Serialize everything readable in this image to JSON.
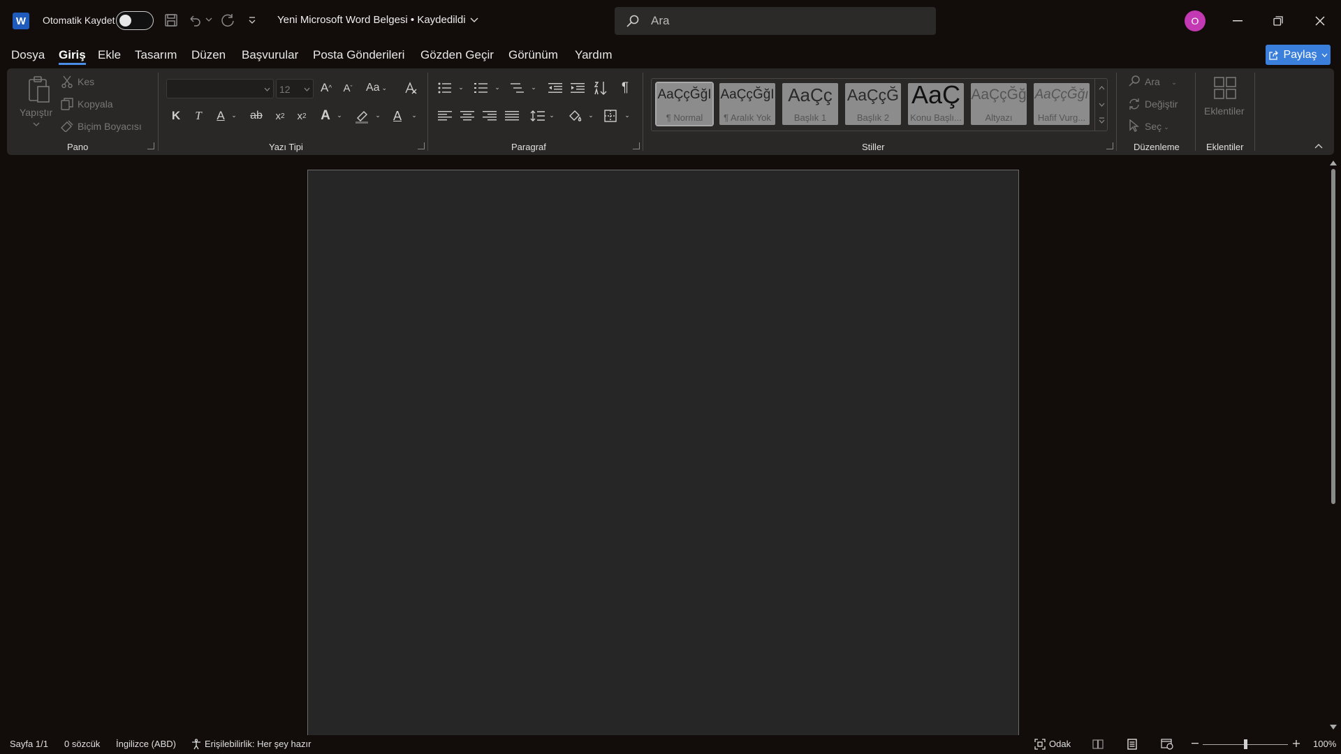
{
  "app": {
    "autosave_label": "Otomatik Kaydet",
    "doc_title": "Yeni Microsoft Word Belgesi • Kaydedildi",
    "search_placeholder": "Ara",
    "avatar_initial": "O",
    "share_label": "Paylaş"
  },
  "menu": {
    "tabs": [
      "Dosya",
      "Giriş",
      "Ekle",
      "Tasarım",
      "Düzen",
      "Başvurular",
      "Posta Gönderileri",
      "Gözden Geçir",
      "Görünüm",
      "Yardım"
    ],
    "active_index": 1
  },
  "ribbon": {
    "clipboard": {
      "paste": "Yapıştır",
      "cut": "Kes",
      "copy": "Kopyala",
      "format_painter": "Biçim Boyacısı",
      "group": "Pano"
    },
    "font": {
      "font_name": "",
      "font_size": "12",
      "case_button": "Aa",
      "bold": "K",
      "italic": "T",
      "underline": "A",
      "strike": "ab",
      "group": "Yazı Tipi"
    },
    "paragraph": {
      "group": "Paragraf"
    },
    "styles": {
      "group": "Stiller",
      "items": [
        {
          "sample": "AaÇçĞğI",
          "name": "¶ Normal"
        },
        {
          "sample": "AaÇçĞğI",
          "name": "¶ Aralık Yok"
        },
        {
          "sample": "AaÇç",
          "name": "Başlık 1"
        },
        {
          "sample": "AaÇçĞ",
          "name": "Başlık 2"
        },
        {
          "sample": "AaÇ",
          "name": "Konu Başlı..."
        },
        {
          "sample": "AaÇçĞğ",
          "name": "Altyazı"
        },
        {
          "sample": "AaÇçĞğı",
          "name": "Hafif Vurg..."
        }
      ]
    },
    "editing": {
      "find": "Ara",
      "replace": "Değiştir",
      "select": "Seç",
      "group": "Düzenleme"
    },
    "addins": {
      "button": "Eklentiler",
      "group": "Eklentiler"
    }
  },
  "status": {
    "page": "Sayfa 1/1",
    "words": "0 sözcük",
    "language": "İngilizce (ABD)",
    "accessibility": "Erişilebilirlik: Her şey hazır",
    "focus": "Odak",
    "zoom": "100%",
    "zoom_fraction": 0.5
  },
  "colors": {
    "accent": "#3a7fdb",
    "avatar": "#c239b3",
    "background": "#120d0b",
    "ribbon": "#2a2827",
    "page": "#262626"
  }
}
